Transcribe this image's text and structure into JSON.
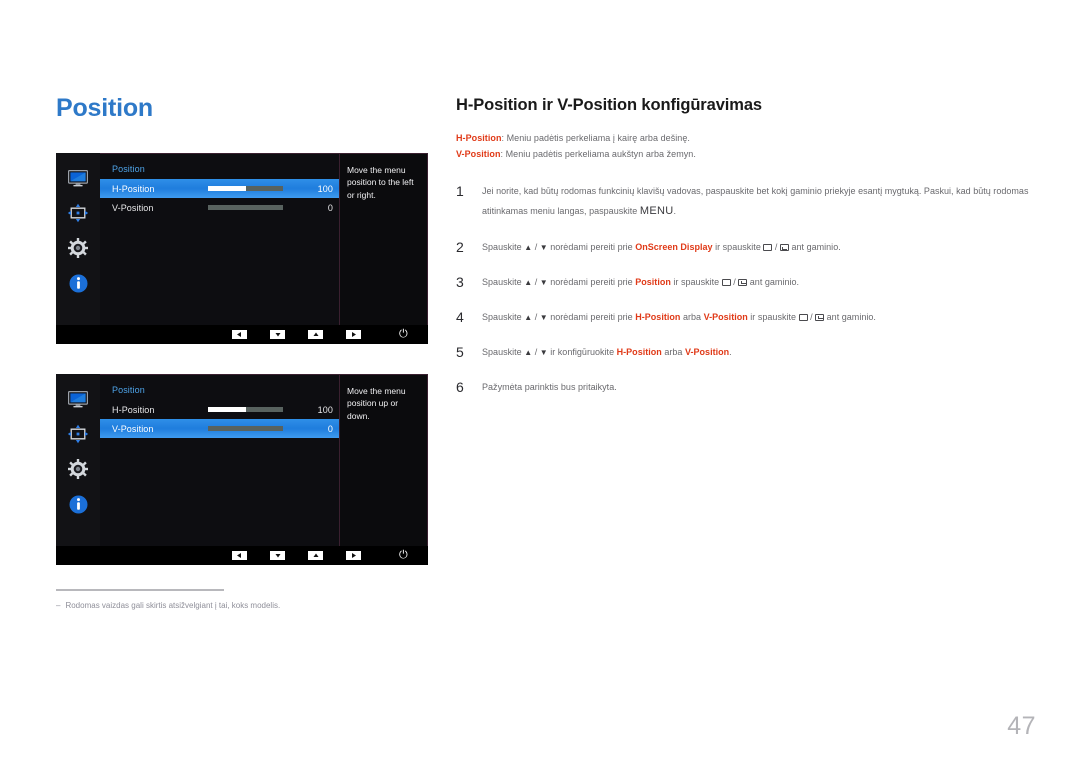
{
  "page_title": "Position",
  "page_number": "47",
  "osd_panels": [
    {
      "name": "h-position-panel",
      "menu_title": "Position",
      "rail_icons": [
        "monitor-icon",
        "position-icon",
        "gear-icon",
        "info-icon"
      ],
      "rows": [
        {
          "label": "H-Position",
          "value": "100",
          "fill_percent": 50,
          "selected": true
        },
        {
          "label": "V-Position",
          "value": "0",
          "fill_percent": 0,
          "selected": false
        }
      ],
      "help_text": "Move the menu position to the left or right.",
      "buttons": [
        "left-arrow-key",
        "down-arrow-key",
        "up-arrow-key",
        "right-arrow-key"
      ],
      "power_glyph": "⏻"
    },
    {
      "name": "v-position-panel",
      "menu_title": "Position",
      "rail_icons": [
        "monitor-icon",
        "position-icon",
        "gear-icon",
        "info-icon"
      ],
      "rows": [
        {
          "label": "H-Position",
          "value": "100",
          "fill_percent": 50,
          "selected": false
        },
        {
          "label": "V-Position",
          "value": "0",
          "fill_percent": 0,
          "selected": true
        }
      ],
      "help_text": "Move the menu position up or down.",
      "buttons": [
        "left-arrow-key",
        "down-arrow-key",
        "up-arrow-key",
        "right-arrow-key"
      ],
      "power_glyph": "⏻"
    }
  ],
  "footnote": {
    "dash": "–",
    "text": "Rodomas vaizdas gali skirtis atsižvelgiant į tai, koks modelis."
  },
  "section": {
    "title": "H-Position ir V-Position konfigūravimas",
    "intro": [
      {
        "keyword": "H-Position",
        "rest": ": Meniu padėtis perkeliama į kairę arba dešinę."
      },
      {
        "keyword": "V-Position",
        "rest": ": Meniu padėtis perkeliama aukštyn arba žemyn."
      }
    ],
    "steps": [
      {
        "num": "1",
        "parts": [
          {
            "t": "Jei norite, kad būtų rodomas funkcinių klavišų vadovas, paspauskite bet kokį gaminio priekyje esantį mygtuką. Paskui, kad būtų rodomas atitinkamas meniu langas, paspauskite ",
            "k": false
          },
          {
            "t": "MENU",
            "k": false,
            "menu": true
          },
          {
            "t": ".",
            "k": false
          }
        ]
      },
      {
        "num": "2",
        "parts": [
          {
            "t": "Spauskite ",
            "k": false
          },
          {
            "t": "▲",
            "k": false,
            "arrow": true
          },
          {
            "t": " / ",
            "k": false
          },
          {
            "t": "▼",
            "k": false,
            "arrow": true
          },
          {
            "t": " norėdami pereiti prie ",
            "k": false
          },
          {
            "t": "OnScreen Display",
            "k": true
          },
          {
            "t": " ir spauskite ",
            "k": false
          },
          {
            "t": "",
            "k": false,
            "back": true
          },
          {
            "t": " / ",
            "k": false
          },
          {
            "t": "",
            "k": false,
            "enter": true
          },
          {
            "t": " ant gaminio.",
            "k": false
          }
        ]
      },
      {
        "num": "3",
        "parts": [
          {
            "t": "Spauskite ",
            "k": false
          },
          {
            "t": "▲",
            "k": false,
            "arrow": true
          },
          {
            "t": " / ",
            "k": false
          },
          {
            "t": "▼",
            "k": false,
            "arrow": true
          },
          {
            "t": " norėdami pereiti prie ",
            "k": false
          },
          {
            "t": "Position",
            "k": true
          },
          {
            "t": " ir spauskite ",
            "k": false
          },
          {
            "t": "",
            "k": false,
            "back": true
          },
          {
            "t": " / ",
            "k": false
          },
          {
            "t": "",
            "k": false,
            "enter": true
          },
          {
            "t": " ant gaminio.",
            "k": false
          }
        ]
      },
      {
        "num": "4",
        "parts": [
          {
            "t": "Spauskite ",
            "k": false
          },
          {
            "t": "▲",
            "k": false,
            "arrow": true
          },
          {
            "t": " / ",
            "k": false
          },
          {
            "t": "▼",
            "k": false,
            "arrow": true
          },
          {
            "t": " norėdami pereiti prie ",
            "k": false
          },
          {
            "t": "H-Position",
            "k": true
          },
          {
            "t": " arba ",
            "k": false
          },
          {
            "t": "V-Position",
            "k": true
          },
          {
            "t": " ir spauskite ",
            "k": false
          },
          {
            "t": "",
            "k": false,
            "back": true
          },
          {
            "t": " / ",
            "k": false
          },
          {
            "t": "",
            "k": false,
            "enter": true
          },
          {
            "t": " ant gaminio.",
            "k": false
          }
        ]
      },
      {
        "num": "5",
        "parts": [
          {
            "t": "Spauskite ",
            "k": false
          },
          {
            "t": "▲",
            "k": false,
            "arrow": true
          },
          {
            "t": " / ",
            "k": false
          },
          {
            "t": "▼",
            "k": false,
            "arrow": true
          },
          {
            "t": " ir konfigūruokite ",
            "k": false
          },
          {
            "t": "H-Position",
            "k": true
          },
          {
            "t": " arba ",
            "k": false
          },
          {
            "t": "V-Position",
            "k": true
          },
          {
            "t": ".",
            "k": false
          }
        ]
      },
      {
        "num": "6",
        "parts": [
          {
            "t": "Pažymėta parinktis bus pritaikyta.",
            "k": false
          }
        ]
      }
    ]
  },
  "colors": {
    "title_blue": "#2e79c8",
    "keyword_red": "#e03a18",
    "osd_highlight": "#2f8fe8",
    "osd_heading_blue": "#4ea3e8",
    "body_gray": "#6a6a6e",
    "page_number_gray": "#b4b4b8"
  }
}
